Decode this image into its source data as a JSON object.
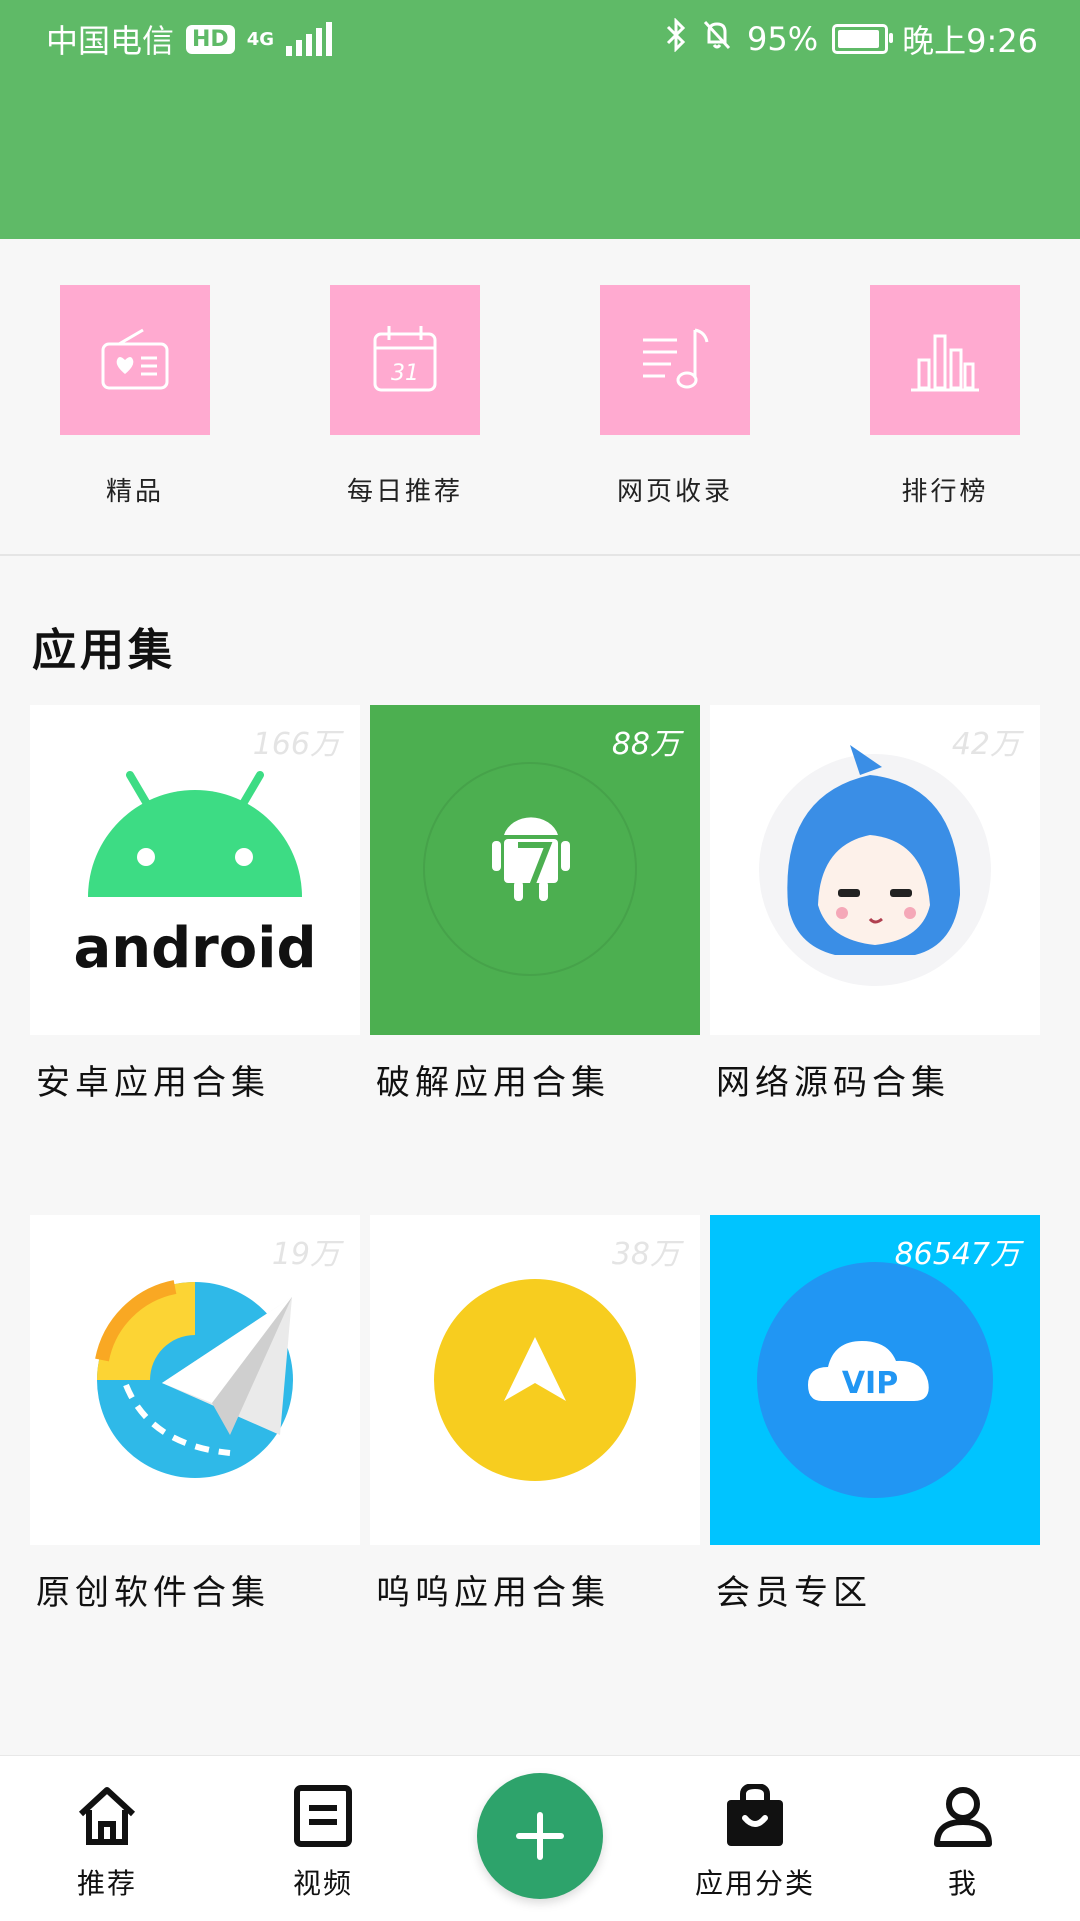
{
  "status_bar": {
    "carrier": "中国电信",
    "hd": "HD",
    "network": "4G",
    "battery": "95%",
    "time": "晚上9:26"
  },
  "categories": [
    {
      "label": "精品",
      "icon": "radio-heart-icon"
    },
    {
      "label": "每日推荐",
      "icon": "calendar-31-icon"
    },
    {
      "label": "网页收录",
      "icon": "music-list-icon"
    },
    {
      "label": "排行榜",
      "icon": "bar-chart-icon"
    }
  ],
  "section": {
    "title": "应用集",
    "cards": [
      {
        "name": "安卓应用合集",
        "count": "166万",
        "bg": "#ffffff"
      },
      {
        "name": "破解应用合集",
        "count": "88万",
        "bg": "#4caf50"
      },
      {
        "name": "网络源码合集",
        "count": "42万",
        "bg": "#ffffff"
      },
      {
        "name": "原创软件合集",
        "count": "19万",
        "bg": "#ffffff"
      },
      {
        "name": "呜呜应用合集",
        "count": "38万",
        "bg": "#ffffff"
      },
      {
        "name": "会员专区",
        "count": "86547万",
        "bg": "#00c4ff"
      }
    ],
    "android_logo_text": "android",
    "vip_text": "VIP"
  },
  "bottom_nav": {
    "items": [
      {
        "label": "推荐",
        "icon": "home-icon"
      },
      {
        "label": "视频",
        "icon": "document-icon"
      },
      {
        "label": "应用分类",
        "icon": "shopping-bag-icon"
      },
      {
        "label": "我",
        "icon": "user-icon"
      }
    ],
    "fab_icon": "plus-icon"
  },
  "colors": {
    "header_green": "#5fba67",
    "tile_pink": "#ffaad0",
    "fab_green": "#2da36b"
  }
}
